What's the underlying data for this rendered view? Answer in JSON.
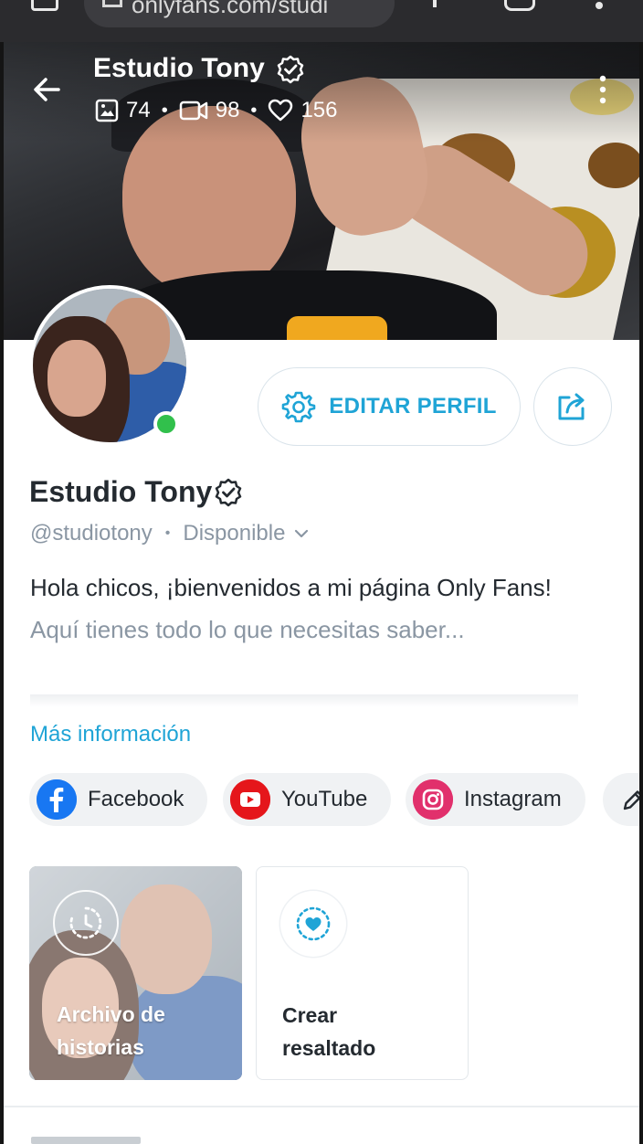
{
  "browser": {
    "url_text": "onlyfans.com/studi"
  },
  "profile": {
    "cover_title": "Estudio Tony",
    "stats": {
      "photos": "74",
      "videos": "98",
      "likes": "156",
      "separator": "•"
    },
    "edit_profile_label": "EDITAR PERFIL",
    "name": "Estudio Tony",
    "handle": "@studiotony",
    "separator": "•",
    "status": "Disponible",
    "bio_line1": "Hola chicos, ¡bienvenidos a mi página Only Fans!",
    "bio_line2": "Aquí tienes todo lo que necesitas saber...",
    "more_info_label": "Más información",
    "online": true
  },
  "socials": [
    {
      "label": "Facebook",
      "icon": "facebook-icon",
      "color": "#1877f2"
    },
    {
      "label": "YouTube",
      "icon": "youtube-icon",
      "color": "#e5161b"
    },
    {
      "label": "Instagram",
      "icon": "instagram-icon",
      "color": "#e1306c"
    }
  ],
  "highlights": {
    "archive_line1": "Archivo de",
    "archive_line2": "historias",
    "create_line1": "Crear",
    "create_line2": "resaltado"
  },
  "colors": {
    "accent": "#1fa4d6",
    "online": "#31c04c",
    "text": "#242a30",
    "muted": "#8a96a3"
  }
}
